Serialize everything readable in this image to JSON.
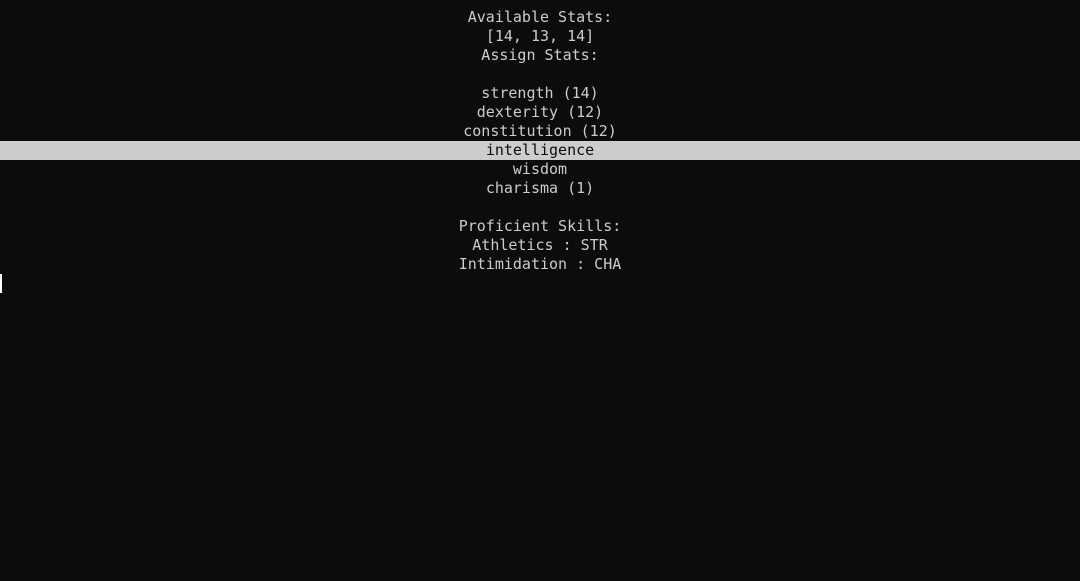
{
  "header": {
    "available_label": "Available Stats:",
    "available_values": "[14, 13, 14]",
    "assign_label": "Assign Stats:"
  },
  "stats": [
    {
      "label": "strength (14)",
      "selected": false
    },
    {
      "label": "dexterity (12)",
      "selected": false
    },
    {
      "label": "constitution (12)",
      "selected": false
    },
    {
      "label": "intelligence",
      "selected": true
    },
    {
      "label": "wisdom",
      "selected": false
    },
    {
      "label": "charisma (1)",
      "selected": false
    }
  ],
  "skills": {
    "label": "Proficient Skills:",
    "items": [
      "Athletics : STR",
      "Intimidation : CHA"
    ]
  },
  "colors": {
    "background": "#0c0c0c",
    "text": "#cccccc",
    "selection_bg": "#cccccc",
    "selection_text": "#0c0c0c"
  }
}
